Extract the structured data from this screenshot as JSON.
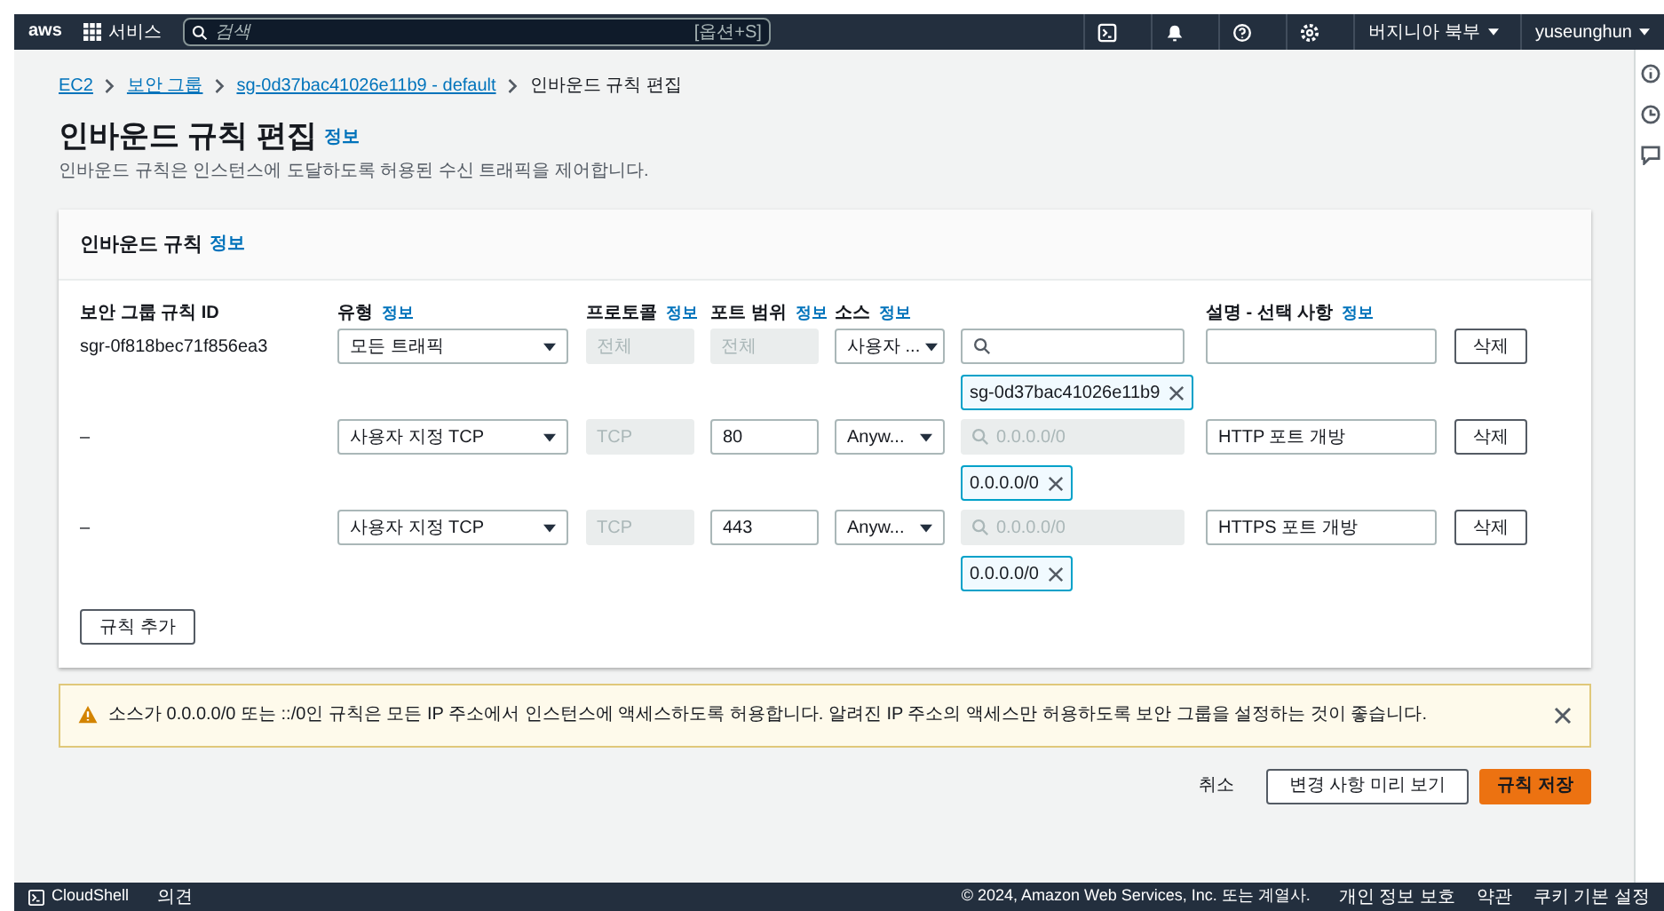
{
  "nav": {
    "logo": "aws",
    "services": "서비스",
    "search": {
      "placeholder": "검색",
      "shortcut": "[옵션+S]"
    },
    "region": "버지니아 북부",
    "user": "yuseunghun"
  },
  "breadcrumbs": [
    {
      "label": "EC2",
      "link": true
    },
    {
      "label": "보안 그룹",
      "link": true
    },
    {
      "label": "sg-0d37bac41026e11b9 - default",
      "link": true
    },
    {
      "label": "인바운드 규칙 편집",
      "link": false
    }
  ],
  "title": "인바운드 규칙 편집",
  "title_info": "정보",
  "description": "인바운드 규칙은 인스턴스에 도달하도록 허용된 수신 트래픽을 제어합니다.",
  "panel": {
    "title": "인바운드 규칙",
    "info": "정보",
    "columns": [
      {
        "label": "보안 그룹 규칙 ID"
      },
      {
        "label": "유형",
        "info": "정보"
      },
      {
        "label": "프로토콜",
        "info": "정보"
      },
      {
        "label": "포트 범위",
        "info": "정보"
      },
      {
        "label": "소스",
        "info": "정보"
      },
      {
        "label": "설명 - 선택 사항",
        "info": "정보"
      }
    ],
    "rows": [
      {
        "rule_id": "sgr-0f818bec71f856ea3",
        "type": "모든 트래픽",
        "protocol": "전체",
        "port": {
          "value": "전체",
          "disabled": true
        },
        "source_type": "사용자 ...",
        "source_search": {
          "disabled": false
        },
        "chips": [
          "sg-0d37bac41026e11b9"
        ],
        "description": "",
        "delete": "삭제"
      },
      {
        "rule_id": "–",
        "type": "사용자 지정 TCP",
        "protocol": "TCP",
        "port": {
          "value": "80",
          "disabled": false
        },
        "source_type": "Anyw...",
        "source_search": {
          "placeholder": "0.0.0.0/0",
          "disabled": true
        },
        "chips": [
          "0.0.0.0/0"
        ],
        "description": "HTTP 포트 개방",
        "delete": "삭제"
      },
      {
        "rule_id": "–",
        "type": "사용자 지정 TCP",
        "protocol": "TCP",
        "port": {
          "value": "443",
          "disabled": false
        },
        "source_type": "Anyw...",
        "source_search": {
          "placeholder": "0.0.0.0/0",
          "disabled": true
        },
        "chips": [
          "0.0.0.0/0"
        ],
        "description": "HTTPS 포트 개방",
        "delete": "삭제"
      }
    ],
    "add_rule": "규칙 추가"
  },
  "warning": "소스가 0.0.0.0/0 또는 ::/0인 규칙은 모든 IP 주소에서 인스턴스에 액세스하도록 허용합니다. 알려진 IP 주소의 액세스만 허용하도록 보안 그룹을 설정하는 것이 좋습니다.",
  "actions": {
    "cancel": "취소",
    "preview": "변경 사항 미리 보기",
    "save": "규칙 저장"
  },
  "footer": {
    "cloudshell": "CloudShell",
    "feedback": "의견",
    "copyright": "© 2024, Amazon Web Services, Inc. 또는 계열사.",
    "privacy": "개인 정보 보호",
    "terms": "약관",
    "cookies": "쿠키 기본 설정"
  }
}
